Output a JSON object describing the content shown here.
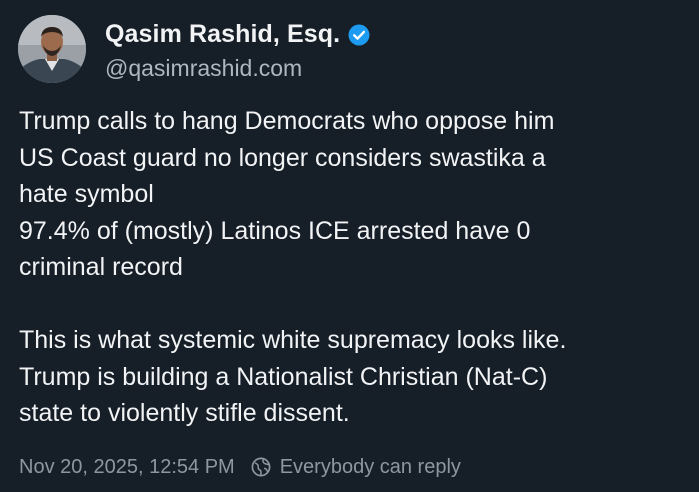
{
  "post": {
    "author": {
      "display_name": "Qasim Rashid, Esq.",
      "handle": "@qasimrashid.com",
      "verified_icon": "verified-badge-icon",
      "avatar": "avatar"
    },
    "text_lines": [
      "Trump calls to hang Democrats who oppose him",
      "US Coast guard no longer considers swastika a",
      "hate symbol",
      "97.4% of (mostly) Latinos ICE arrested have 0",
      "criminal record",
      "",
      "This is what systemic white supremacy looks like.",
      "Trump is building a Nationalist Christian (Nat-C)",
      "state to violently stifle dissent."
    ],
    "timestamp": "Nov 20, 2025, 12:54 PM",
    "reply_setting": {
      "icon": "globe-reply-icon",
      "label": "Everybody can reply"
    }
  },
  "colors": {
    "background": "#161e27",
    "text_primary": "#f1f3f5",
    "text_secondary": "#aeb7c1",
    "meta_text": "#8e97a1",
    "verified_blue": "#1d9bf0"
  }
}
